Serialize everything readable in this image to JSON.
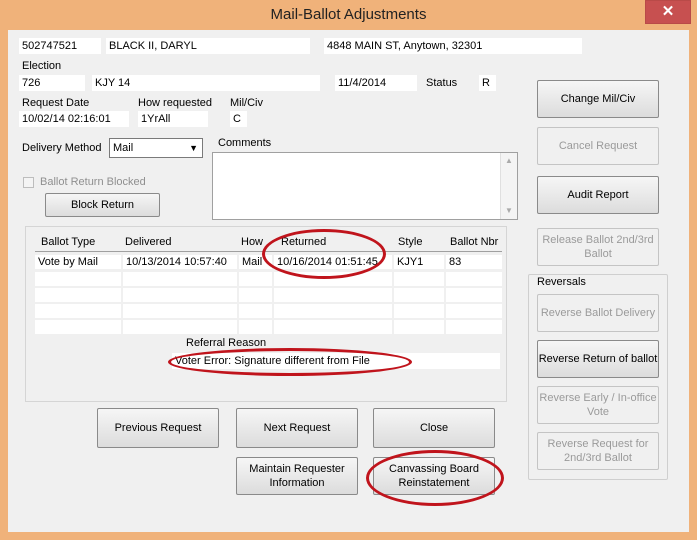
{
  "window": {
    "title": "Mail-Ballot Adjustments",
    "close_glyph": "✕"
  },
  "voter": {
    "id": "502747521",
    "name": "BLACK II, DARYL",
    "address": "4848 MAIN ST, Anytown, 32301"
  },
  "election": {
    "label": "Election",
    "code": "726",
    "name": "KJY 14",
    "date": "11/4/2014",
    "status_label": "Status",
    "status_value": "R"
  },
  "request": {
    "date_label": "Request Date",
    "date_value": "10/02/14 02:16:01",
    "how_label": "How requested",
    "how_value": "1YrAll",
    "milciv_label": "Mil/Civ",
    "milciv_value": "C"
  },
  "delivery": {
    "label": "Delivery Method",
    "value": "Mail"
  },
  "comments": {
    "label": "Comments",
    "value": ""
  },
  "ballot_return_blocked": {
    "label": "Ballot Return Blocked",
    "checked": false
  },
  "block_return_button": "Block Return",
  "ballot_table": {
    "columns": [
      "Ballot Type",
      "Delivered",
      "How",
      "Returned",
      "Style",
      "Ballot Nbr"
    ],
    "rows": [
      [
        "Vote by Mail",
        "10/13/2014 10:57:40",
        "Mail",
        "10/16/2014 01:51:45",
        "KJY1",
        "83"
      ]
    ],
    "empty_rows": 4
  },
  "referral": {
    "label": "Referral Reason",
    "value": "Voter Error: Signature different from File"
  },
  "buttons": {
    "previous_request": "Previous Request",
    "next_request": "Next Request",
    "close": "Close",
    "maintain_requester": "Maintain Requester Information",
    "canvassing_board": "Canvassing Board Reinstatement"
  },
  "side_buttons": {
    "change_mil_civ": "Change Mil/Civ",
    "cancel_request": "Cancel Request",
    "audit_report": "Audit Report",
    "release_ballot": "Release Ballot 2nd/3rd Ballot"
  },
  "reversals": {
    "label": "Reversals",
    "reverse_ballot_delivery": "Reverse Ballot Delivery",
    "reverse_return_of_ballot": "Reverse Return of ballot",
    "reverse_early": "Reverse Early / In-office Vote",
    "reverse_request": "Reverse Request for 2nd/3rd Ballot"
  },
  "colors": {
    "window_frame": "#f0b27a",
    "annotation_red": "#c0141c",
    "client_bg": "#f0f0f0"
  }
}
